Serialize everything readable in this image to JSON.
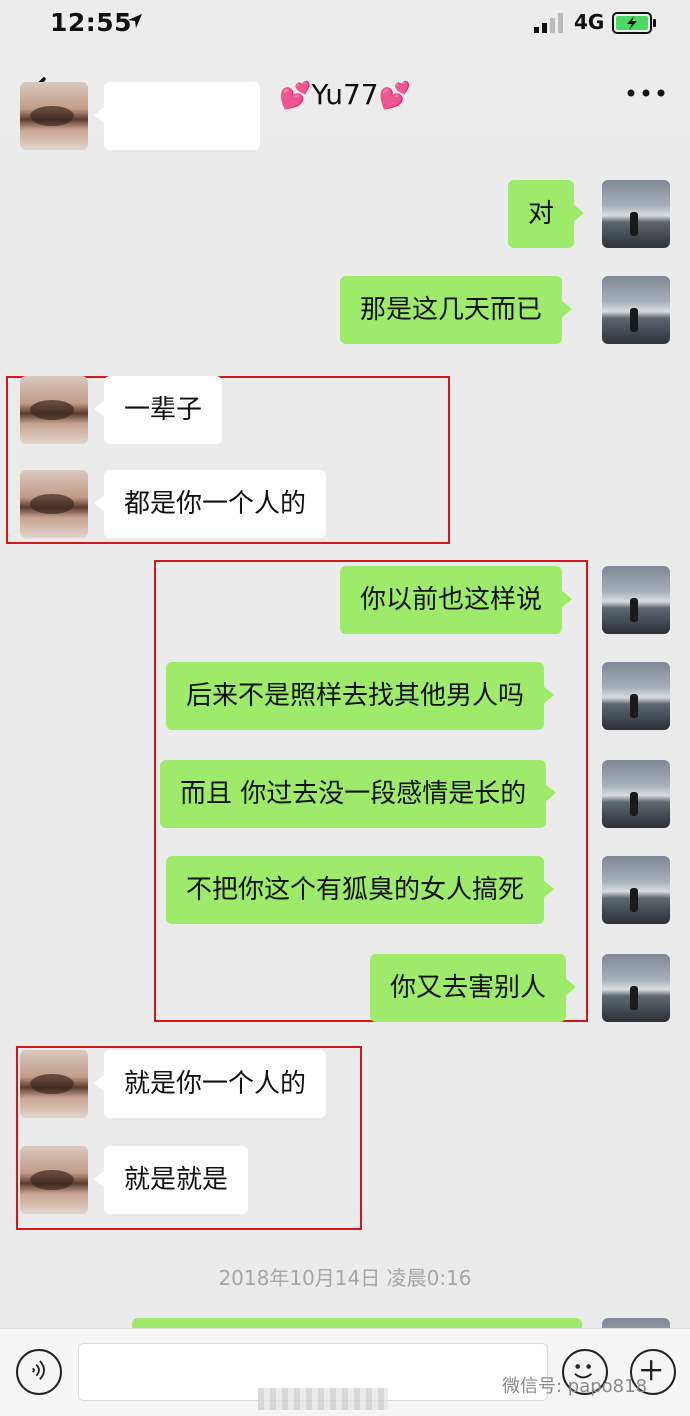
{
  "status_bar": {
    "time": "12:55",
    "network": "4G",
    "icons": [
      "location-arrow-icon",
      "signal-icon",
      "battery-charging-icon"
    ]
  },
  "nav": {
    "title": "Yu77",
    "title_decoration": "💕",
    "icons": [
      "back-chevron-icon",
      "more-dots-icon"
    ]
  },
  "messages": [
    {
      "side": "her",
      "text": ""
    },
    {
      "side": "me",
      "text": "对"
    },
    {
      "side": "me",
      "text": "那是这几天而已"
    },
    {
      "side": "her",
      "text": "一辈子"
    },
    {
      "side": "her",
      "text": "都是你一个人的"
    },
    {
      "side": "me",
      "text": "你以前也这样说"
    },
    {
      "side": "me",
      "text": "后来不是照样去找其他男人吗"
    },
    {
      "side": "me",
      "text": "而且 你过去没一段感情是长的"
    },
    {
      "side": "me",
      "text": "不把你这个有狐臭的女人搞死"
    },
    {
      "side": "me",
      "text": "你又去害别人"
    },
    {
      "side": "her",
      "text": "就是你一个人的"
    },
    {
      "side": "her",
      "text": "就是就是"
    },
    {
      "side": "me",
      "text": ""
    }
  ],
  "timestamp": "2018年10月14日 凌晨0:16",
  "input_bar": {
    "icons": [
      "voice-icon",
      "emoji-icon",
      "plus-icon"
    ],
    "input_value": ""
  },
  "watermark": "微信号: papo818",
  "colors": {
    "background": "#ebebeb",
    "my_bubble": "#9eea6a",
    "her_bubble": "#ffffff",
    "highlight_box": "#d21919",
    "heart": "#f0479a"
  }
}
